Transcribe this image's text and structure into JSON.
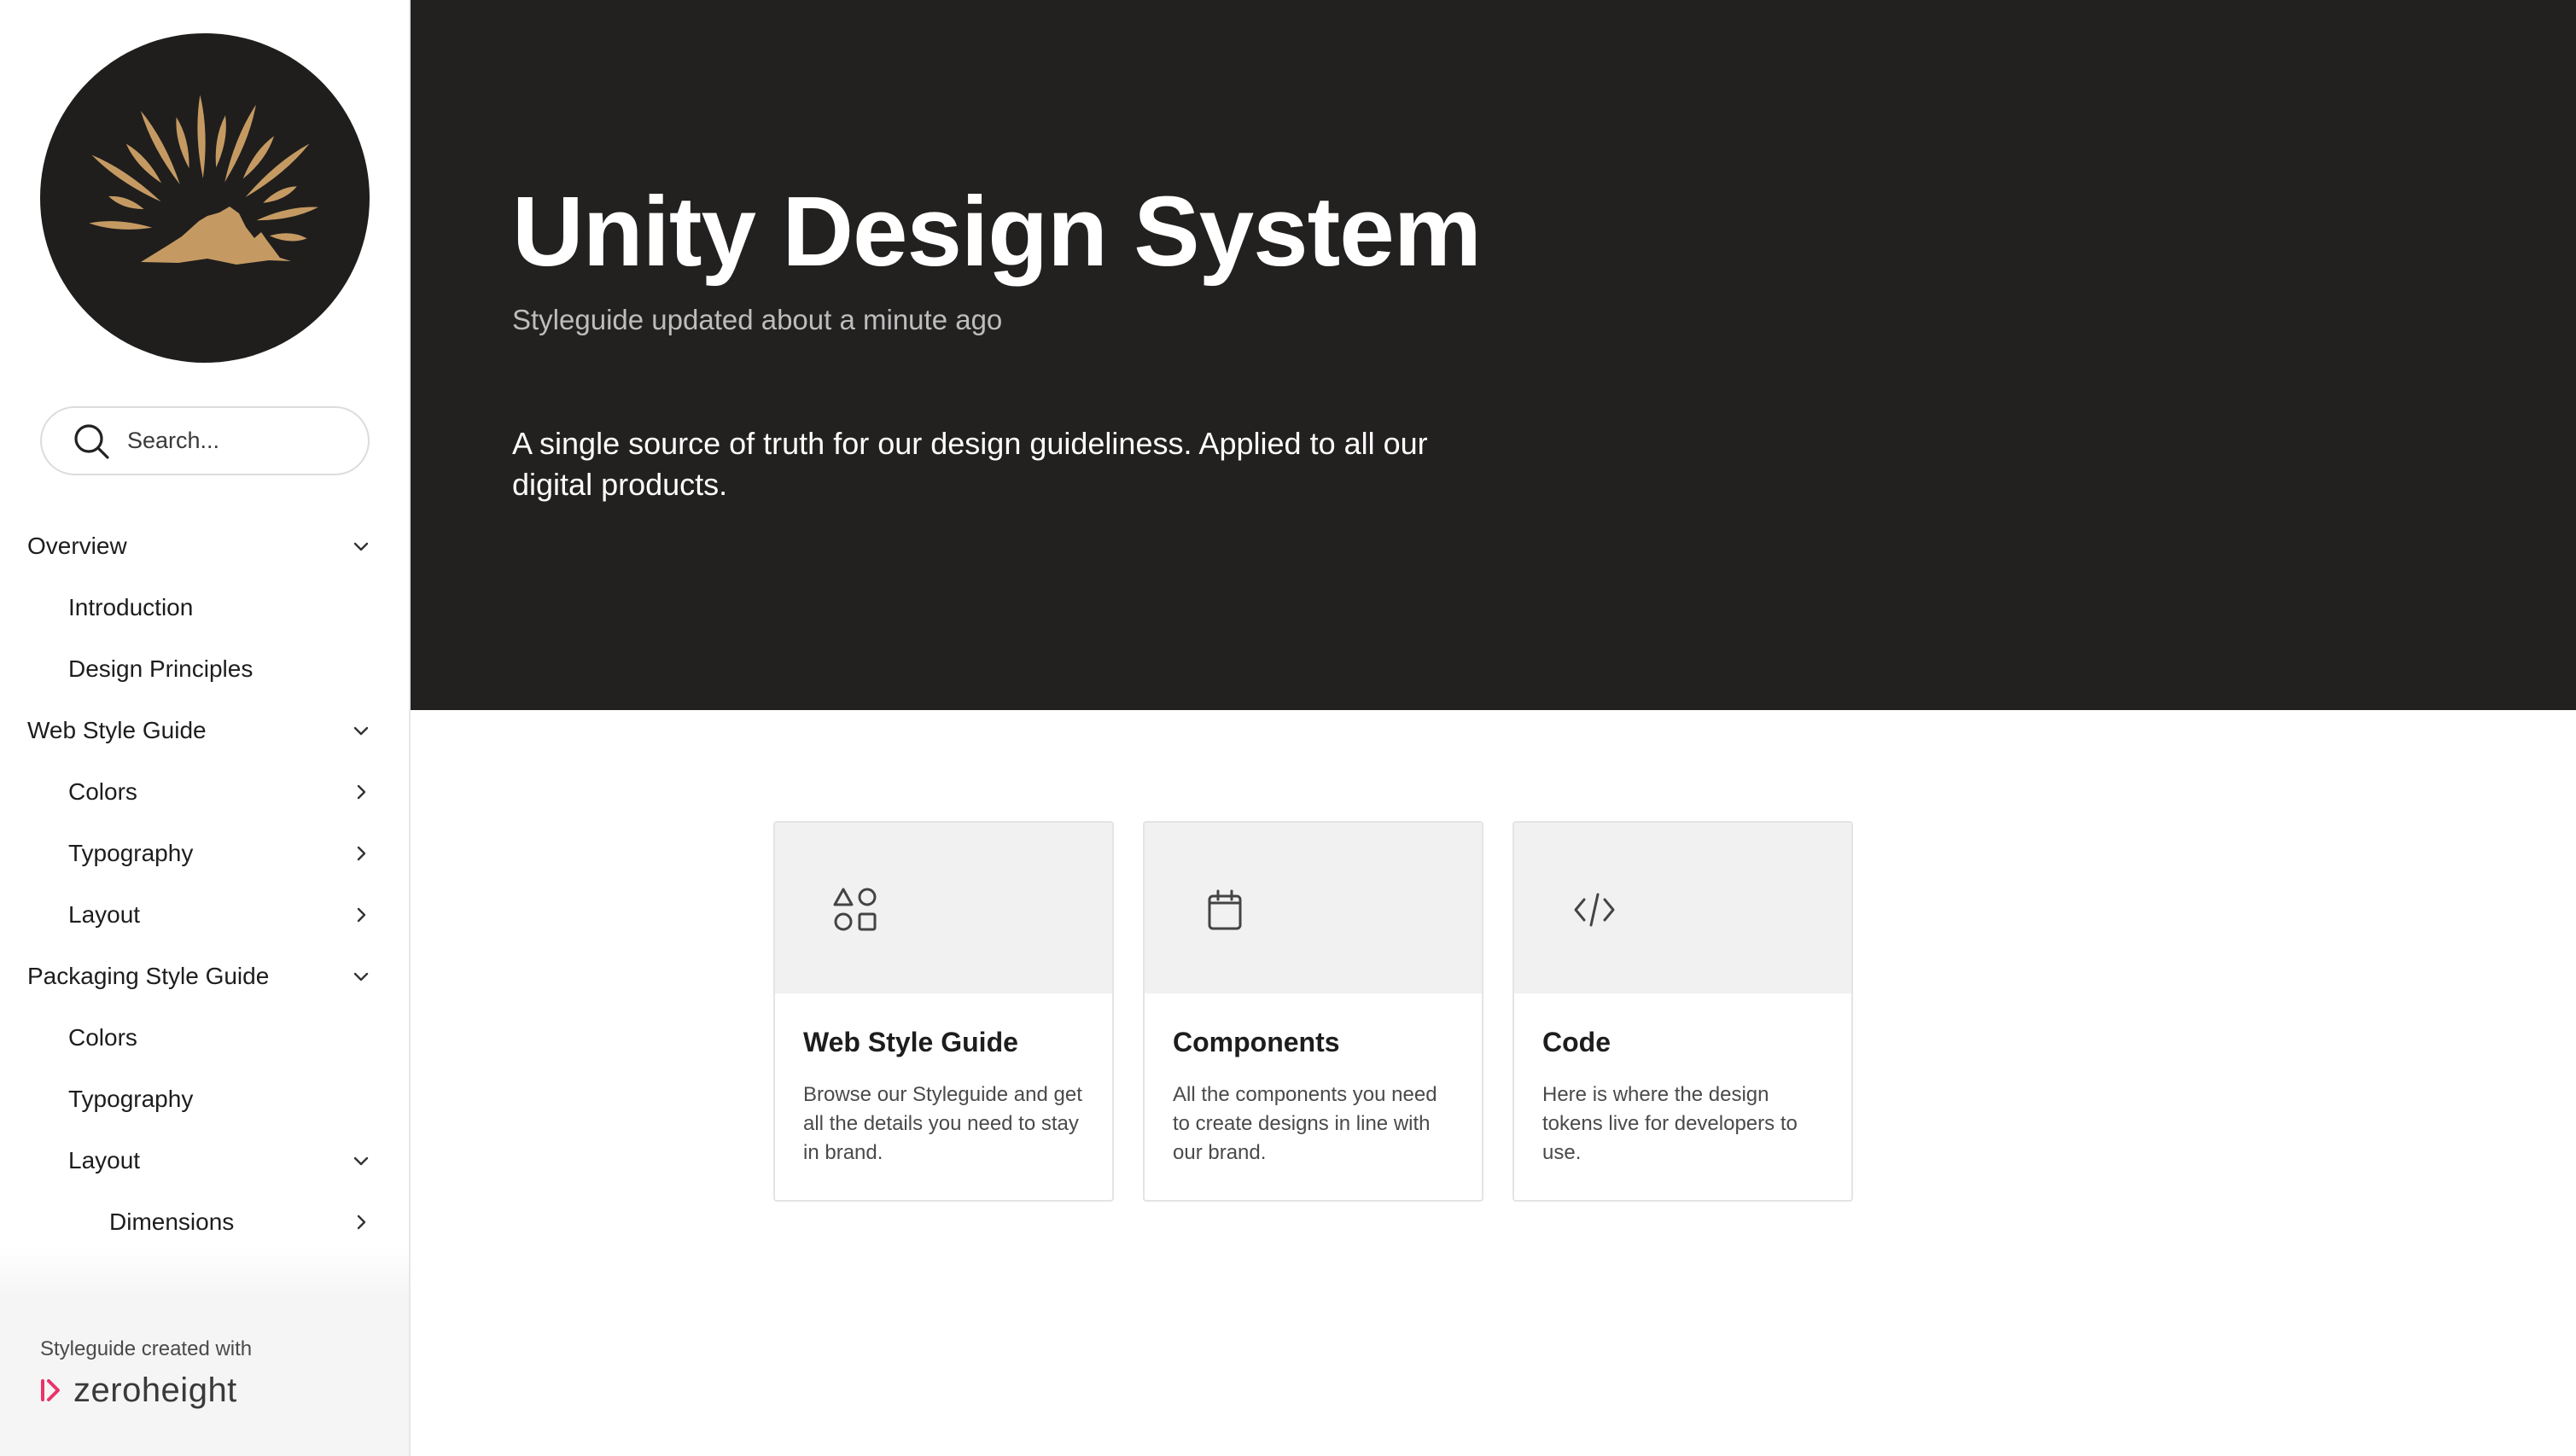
{
  "brand": {
    "accent": "#c59a62",
    "dark": "#222120",
    "zeroheight_accent": "#e8336b"
  },
  "sidebar": {
    "logo_icon": "sunrise-mountain-logo",
    "search": {
      "placeholder": "Search...",
      "icon": "search-icon"
    },
    "nav": [
      {
        "label": "Overview",
        "level": 0,
        "chevron": "down"
      },
      {
        "label": "Introduction",
        "level": 1,
        "chevron": "none"
      },
      {
        "label": "Design Principles",
        "level": 1,
        "chevron": "none"
      },
      {
        "label": "Web Style Guide",
        "level": 0,
        "chevron": "down"
      },
      {
        "label": "Colors",
        "level": 1,
        "chevron": "right"
      },
      {
        "label": "Typography",
        "level": 1,
        "chevron": "right"
      },
      {
        "label": "Layout",
        "level": 1,
        "chevron": "right"
      },
      {
        "label": "Packaging Style Guide",
        "level": 0,
        "chevron": "down"
      },
      {
        "label": "Colors",
        "level": 1,
        "chevron": "none"
      },
      {
        "label": "Typography",
        "level": 1,
        "chevron": "none"
      },
      {
        "label": "Layout",
        "level": 1,
        "chevron": "down"
      },
      {
        "label": "Dimensions",
        "level": 2,
        "chevron": "right"
      }
    ],
    "footer": {
      "created_with": "Styleguide created with",
      "brand_name": "zeroheight"
    }
  },
  "hero": {
    "title": "Unity Design System",
    "updated": "Styleguide updated about a minute ago",
    "description": "A single source of truth for our design guideliness. Applied to all our digital products."
  },
  "cards": [
    {
      "title": "Web Style Guide",
      "description": "Browse our Styleguide and get all the details you need to stay in brand.",
      "icon": "shapes-icon"
    },
    {
      "title": "Components",
      "description": "All the components you need to create designs in line with our brand.",
      "icon": "component-icon"
    },
    {
      "title": "Code",
      "description": "Here is where the design tokens live for developers to use.",
      "icon": "code-icon"
    }
  ]
}
